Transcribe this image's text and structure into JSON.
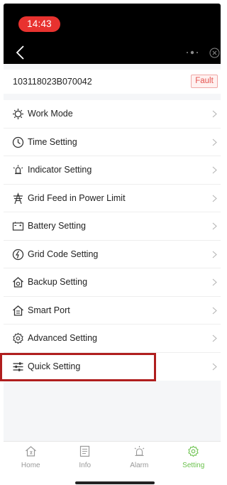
{
  "status_bar": {
    "time": "14:43"
  },
  "device": {
    "serial": "103118023B070042",
    "status_badge": "Fault"
  },
  "menu": {
    "items": [
      {
        "label": "Work Mode",
        "icon": "gear-outline-icon"
      },
      {
        "label": "Time Setting",
        "icon": "clock-icon"
      },
      {
        "label": "Indicator Setting",
        "icon": "indicator-icon"
      },
      {
        "label": "Grid Feed in Power Limit",
        "icon": "grid-tower-icon"
      },
      {
        "label": "Battery Setting",
        "icon": "battery-icon"
      },
      {
        "label": "Grid Code Setting",
        "icon": "grid-code-icon"
      },
      {
        "label": "Backup Setting",
        "icon": "backup-house-icon"
      },
      {
        "label": "Smart Port",
        "icon": "smart-port-icon"
      },
      {
        "label": "Advanced Setting",
        "icon": "advanced-gear-icon"
      },
      {
        "label": "Quick Setting",
        "icon": "sliders-icon"
      }
    ]
  },
  "tabbar": {
    "tabs": [
      {
        "label": "Home",
        "icon": "home-icon"
      },
      {
        "label": "Info",
        "icon": "info-doc-icon"
      },
      {
        "label": "Alarm",
        "icon": "alarm-icon"
      },
      {
        "label": "Setting",
        "icon": "setting-gear-icon",
        "active": true
      }
    ]
  },
  "colors": {
    "accent_active": "#6bc24d",
    "time_pill": "#e8322f",
    "fault_text": "#e45450",
    "highlight_box": "#b01e1e"
  }
}
